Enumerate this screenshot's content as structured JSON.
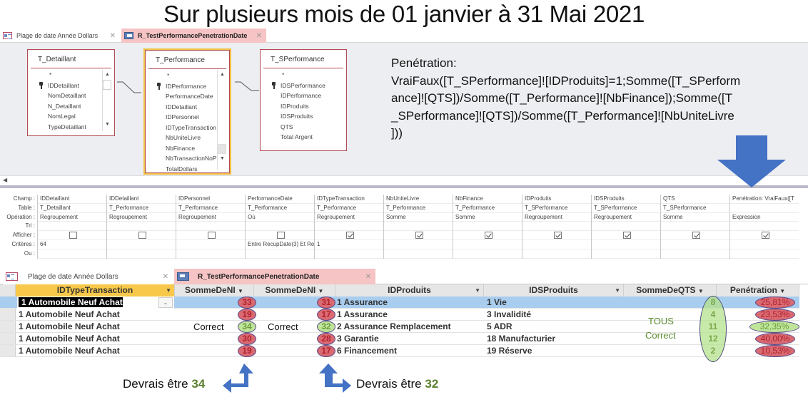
{
  "title": "Sur plusieurs mois de 01 janvier à 31 Mai 2021",
  "tabs": [
    {
      "label": "Plage de date Année Dollars",
      "icon": "form-icon",
      "active": false
    },
    {
      "label": "R_TestPerformancePenetrationDate",
      "icon": "query-icon",
      "active": true
    }
  ],
  "design": {
    "tables": [
      {
        "name": "T_Detaillant",
        "fields": [
          "*",
          "IDDetaillant",
          "NomDetaillant",
          "N_Detaillant",
          "NomLegal",
          "TypeDetaillant"
        ],
        "key_field": "IDDetaillant"
      },
      {
        "name": "T_Performance",
        "fields": [
          "*",
          "IDPerformance",
          "PerformanceDate",
          "IDDetaillant",
          "IDPersonnel",
          "IDTypeTransaction",
          "NbUniteLivre",
          "NbFinance",
          "NbTransactionNoP",
          "TotalDollars"
        ],
        "key_field": "IDPerformance"
      },
      {
        "name": "T_SPerformance",
        "fields": [
          "*",
          "IDSPerformance",
          "IDPerformance",
          "IDProduits",
          "IDSProduits",
          "QTS",
          "Total Argent"
        ],
        "key_field": "IDSPerformance"
      }
    ],
    "formula_lines": [
      "Penétration:",
      "VraiFaux([T_SPerformance]![IDProduits]=1;Somme([T_SPerform",
      "ance]![QTS])/Somme([T_Performance]![NbFinance]);Somme([T",
      "_SPerformance]![QTS])/Somme([T_Performance]![NbUniteLivre",
      "]))"
    ]
  },
  "grid": {
    "row_labels": [
      "Champ :",
      "Table :",
      "Opération :",
      "Tri :",
      "Afficher :",
      "Critères :",
      "Ou :"
    ],
    "columns": [
      {
        "champ": "IDDetaillant",
        "table": "T_Detaillant",
        "operation": "Regroupement",
        "tri": "",
        "afficher": false,
        "criteres": "64",
        "ou": ""
      },
      {
        "champ": "IDDetaillant",
        "table": "T_Performance",
        "operation": "Regroupement",
        "tri": "",
        "afficher": false,
        "criteres": "",
        "ou": ""
      },
      {
        "champ": "IDPersonnel",
        "table": "T_Performance",
        "operation": "Regroupement",
        "tri": "",
        "afficher": false,
        "criteres": "",
        "ou": ""
      },
      {
        "champ": "PerformanceDate",
        "table": "T_Performance",
        "operation": "Où",
        "tri": "",
        "afficher": false,
        "criteres": "Entre RecupDate(3) Et Re",
        "ou": ""
      },
      {
        "champ": "IDTypeTransaction",
        "table": "T_Performance",
        "operation": "Regroupement",
        "tri": "",
        "afficher": true,
        "criteres": "1",
        "ou": ""
      },
      {
        "champ": "NbUniteLivre",
        "table": "T_Performance",
        "operation": "Somme",
        "tri": "",
        "afficher": true,
        "criteres": "",
        "ou": ""
      },
      {
        "champ": "NbFinance",
        "table": "T_Performance",
        "operation": "Somme",
        "tri": "",
        "afficher": true,
        "criteres": "",
        "ou": ""
      },
      {
        "champ": "IDProduits",
        "table": "T_SPerformance",
        "operation": "Regroupement",
        "tri": "",
        "afficher": true,
        "criteres": "",
        "ou": ""
      },
      {
        "champ": "IDSProduits",
        "table": "T_SPerformance",
        "operation": "Regroupement",
        "tri": "",
        "afficher": true,
        "criteres": "",
        "ou": ""
      },
      {
        "champ": "QTS",
        "table": "T_SPerformance",
        "operation": "Somme",
        "tri": "",
        "afficher": true,
        "criteres": "",
        "ou": ""
      },
      {
        "champ": "Penétration: VraiFaux([T",
        "table": "",
        "operation": "Expression",
        "tri": "",
        "afficher": true,
        "criteres": "",
        "ou": ""
      }
    ]
  },
  "datasheet": {
    "tabs": [
      {
        "label": "Plage de date Année Dollars",
        "active": false
      },
      {
        "label": "R_TestPerformancePenetrationDate",
        "active": true
      }
    ],
    "headers": [
      "IDTypeTransaction",
      "SommeDeNI",
      "SommeDeNI",
      "IDProduits",
      "IDSProduits",
      "SommeDeQTS",
      "Penétration"
    ],
    "rows": [
      {
        "type": "1 Automobile Neuf Achat",
        "somme1": "33",
        "somme2": "31",
        "produit": "1 Assurance",
        "sproduit": "1 Vie",
        "qts": "8",
        "penetration": "25,81%",
        "status": "wrong"
      },
      {
        "type": "1 Automobile Neuf Achat",
        "somme1": "19",
        "somme2": "17",
        "produit": "1 Assurance",
        "sproduit": "3 Invalidité",
        "qts": "4",
        "penetration": "23,53%",
        "status": "wrong"
      },
      {
        "type": "1 Automobile Neuf Achat",
        "somme1": "34",
        "somme2": "32",
        "produit": "2 Assurance Remplacement",
        "sproduit": "5 ADR",
        "qts": "11",
        "penetration": "32,35%",
        "status": "correct"
      },
      {
        "type": "1 Automobile Neuf Achat",
        "somme1": "30",
        "somme2": "28",
        "produit": "3 Garantie",
        "sproduit": "18 Manufacturier",
        "qts": "12",
        "penetration": "40,00%",
        "status": "wrong"
      },
      {
        "type": "1 Automobile Neuf Achat",
        "somme1": "19",
        "somme2": "17",
        "produit": "6 Financement",
        "sproduit": "19 Réserve",
        "qts": "2",
        "penetration": "10,53%",
        "status": "wrong"
      }
    ]
  },
  "annotations": {
    "correct1": "Correct",
    "correct2": "Correct",
    "tous": "TOUS",
    "tous_correct": "Correct",
    "devrais1_prefix": "Devrais être",
    "devrais1_value": "34",
    "devrais2_prefix": "Devrais être",
    "devrais2_value": "32"
  },
  "colors": {
    "tab_active": "#f6c4c4",
    "current_row": "#a9cdef",
    "header_selected": "#f8c84a",
    "bubble_wrong": "#d96a72",
    "bubble_correct": "#bfe59a",
    "arrow": "#4472c4",
    "note_green": "#5b8a2e"
  }
}
